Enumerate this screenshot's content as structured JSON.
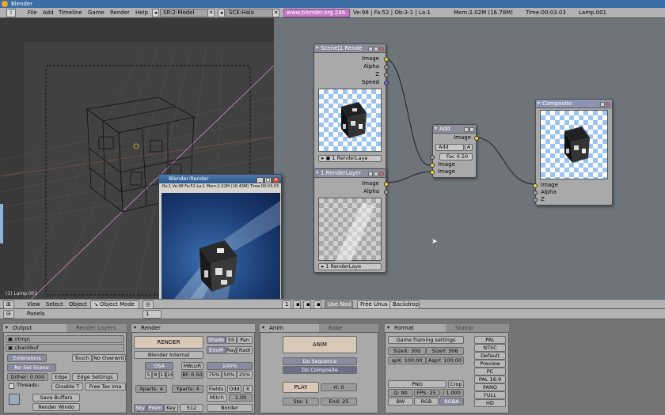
{
  "window": {
    "title": "Blender"
  },
  "menubar": {
    "items": [
      "File",
      "Add",
      "Timeline",
      "Game",
      "Render",
      "Help"
    ],
    "screen": "SR:2-Model",
    "scene": "SCE:Halo",
    "url": "www.blender.org 246",
    "stats": "Ve:98 | Fa:52 | Ob:3-1 | La:1",
    "mem": "Mem:2.02M (16.78M)",
    "time": "Time:00:03.03",
    "object": "Lamp.001"
  },
  "viewport": {
    "label": "(1) Lamp.001"
  },
  "nodes": {
    "scene": {
      "title": "Scene|1 Rende",
      "outputs": [
        "Image",
        "Alpha",
        "Z",
        "Speed"
      ],
      "layer": "1 RenderLaye"
    },
    "renderlayer": {
      "title": "1 RenderLayer",
      "outputs": [
        "Image",
        "Alpha"
      ],
      "layer": "1 RenderLaye"
    },
    "add": {
      "title": "Add",
      "mode": "Add",
      "mode_btn": "A",
      "fac": "Fac 0.50",
      "output": "Image",
      "inputs": [
        "Image",
        "Image"
      ]
    },
    "composite": {
      "title": "Composite",
      "inputs": [
        "Image",
        "Alpha",
        "Z"
      ]
    }
  },
  "renderwindow": {
    "title": "Blender:Render",
    "info": "Rs:1  Ve:98 Fa:52 La:1 Mem:2.02M (16.43M) Time:00:03.03"
  },
  "nodeheader": {
    "view": "View",
    "select": "Select",
    "object": "Object",
    "mode": "Object Mode",
    "frame": "1",
    "use_nodes": "Use Nod",
    "free_unused": "Free Unus",
    "backdrop": "Backdrop"
  },
  "btnheader": {
    "panels": "Panels",
    "frame": "1"
  },
  "panels": {
    "output": {
      "tab1": "Output",
      "tab2": "Render Layers",
      "path1": "//tmp\\",
      "path2": "//backbuf",
      "extensions": "Extensions",
      "touch": "Touch",
      "no_overwrite": "No Overwrit",
      "no_set_scene": "No Set Scene",
      "dither": "Dither: 0.000",
      "edge": "Edge",
      "edge_settings": "Edge Settings",
      "threads": "Threads:",
      "disable_t": "Disable T",
      "free_tex": "Free Tex Ima",
      "save_buffers": "Save Buffers",
      "render_window": "Render Windo"
    },
    "render": {
      "tab": "Render",
      "render_btn": "RENDER",
      "engine": "Blender Internal",
      "shadow": "Shado",
      "ss": "SS",
      "pano": "Pan",
      "envmap": "EnvM",
      "ray": "Ray",
      "radio": "Radi",
      "osa": "OSA",
      "mblur": "MBLUR",
      "osa_vals": [
        "5",
        "8",
        "11",
        "16"
      ],
      "bf": "Bf: 0.50",
      "pct100": "100%",
      "pcts": [
        "75%",
        "50%",
        "25%"
      ],
      "xparts": "Xparts: 4",
      "yparts": "Yparts: 4",
      "fields": "Fields",
      "odd": "Odd",
      "x": "X",
      "gauss": "Mitch",
      "filter": "1.00",
      "sky": "Sky",
      "premul": "Prem",
      "key": "Key",
      "bits": "512",
      "border": "Border"
    },
    "anim": {
      "tab1": "Anim",
      "tab2": "Bake",
      "anim_btn": "ANIM",
      "do_sequence": "Do Sequence",
      "do_composite": "Do Composite",
      "play": "PLAY",
      "rt": "rt: 0",
      "sta": "Sta: 1",
      "end": "End: 25"
    },
    "format": {
      "tab1": "Format",
      "tab2": "Stamp",
      "game_framing": "Game framing settings",
      "sizex": "SizeX: 300",
      "sizey": "SizeY: 306",
      "aspx": "spX: 100.00",
      "aspy": "AspY: 100.00",
      "type": "PNG",
      "crop": "Crop",
      "quality": "Q: 90",
      "fps": "FPS: 25",
      "fps_base": "/ 1.000",
      "bw": "BW",
      "rgb": "RGB",
      "rgba": "RGBA",
      "presets": [
        "PAL",
        "NTSC",
        "Default",
        "Preview",
        "PC",
        "PAL 16:9",
        "PANO",
        "FULL",
        "HD"
      ]
    }
  }
}
